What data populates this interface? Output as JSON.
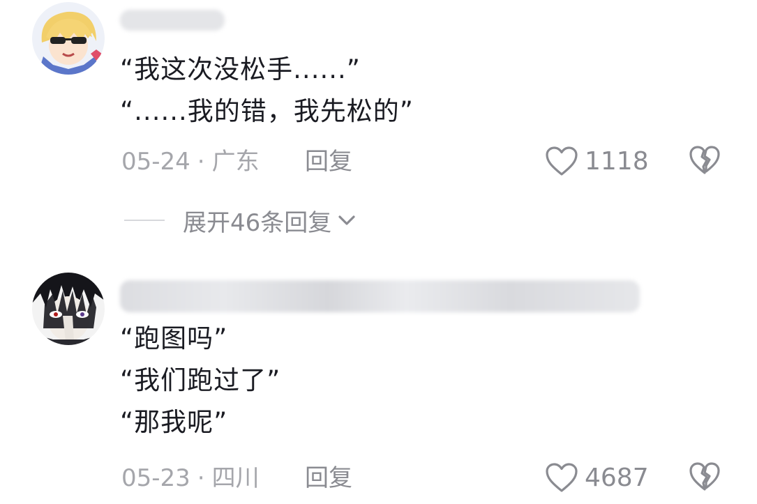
{
  "comments": [
    {
      "lines": [
        "“我这次没松手......”",
        "“......我的错，我先松的”"
      ],
      "date": "05-24",
      "location": "广东",
      "reply_label": "回复",
      "likes": "1118"
    },
    {
      "lines": [
        "“跑图吗”",
        "“我们跑过了”",
        "“那我呢”"
      ],
      "date": "05-23",
      "location": "四川",
      "reply_label": "回复",
      "likes": "4687"
    }
  ],
  "thread": {
    "expand_label": "展开46条回复"
  },
  "meta_separator": "·",
  "colors": {
    "meta_text": "#a5a6ab",
    "action_text": "#8a8b91",
    "body_text": "#1a1b22"
  },
  "icons": [
    "heart-outline-icon",
    "broken-heart-icon",
    "chevron-down-icon"
  ]
}
